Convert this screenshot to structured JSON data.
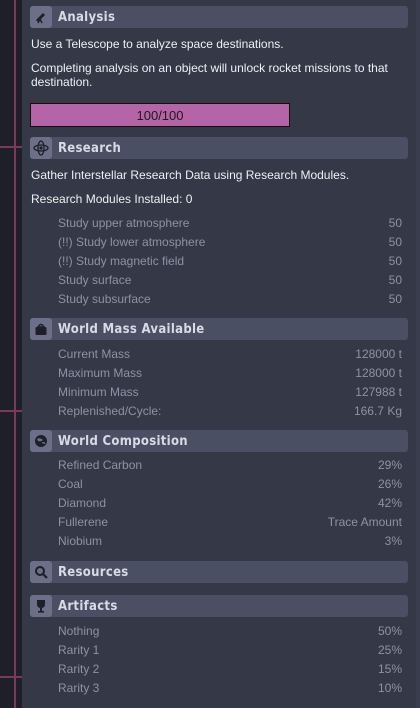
{
  "analysis": {
    "title": "Analysis",
    "icon": "telescope-icon",
    "desc1": "Use a Telescope to analyze space destinations.",
    "desc2": "Completing analysis on an object will unlock rocket missions to that destination.",
    "progress_text": "100/100",
    "progress_value": 1.0
  },
  "research": {
    "title": "Research",
    "icon": "atom-icon",
    "desc": "Gather Interstellar Research Data using Research Modules.",
    "modules": "Research Modules Installed: 0",
    "items": [
      {
        "label": "Study upper atmosphere",
        "value": "50"
      },
      {
        "label": "(!!) Study lower atmosphere",
        "value": "50"
      },
      {
        "label": "(!!) Study magnetic field",
        "value": "50"
      },
      {
        "label": "Study surface",
        "value": "50"
      },
      {
        "label": "Study subsurface",
        "value": "50"
      }
    ]
  },
  "mass": {
    "title": "World Mass Available",
    "icon": "weight-icon",
    "items": [
      {
        "label": "Current Mass",
        "value": "128000 t"
      },
      {
        "label": "Maximum Mass",
        "value": "128000 t"
      },
      {
        "label": "Minimum Mass",
        "value": "127988 t"
      },
      {
        "label": "Replenished/Cycle:",
        "value": "166.7 Kg"
      }
    ]
  },
  "composition": {
    "title": "World Composition",
    "icon": "planet-icon",
    "items": [
      {
        "label": "Refined Carbon",
        "value": "29%"
      },
      {
        "label": "Coal",
        "value": "26%"
      },
      {
        "label": "Diamond",
        "value": "42%"
      },
      {
        "label": "Fullerene",
        "value": "Trace Amount"
      },
      {
        "label": "Niobium",
        "value": "3%"
      }
    ]
  },
  "resources": {
    "title": "Resources",
    "icon": "magnifier-icon"
  },
  "artifacts": {
    "title": "Artifacts",
    "icon": "trophy-icon",
    "items": [
      {
        "label": "Nothing",
        "value": "50%"
      },
      {
        "label": "Rarity 1",
        "value": "25%"
      },
      {
        "label": "Rarity 2",
        "value": "15%"
      },
      {
        "label": "Rarity 3",
        "value": "10%"
      }
    ]
  },
  "colors": {
    "progress_fill": "#b565a7",
    "header_bg": "#4b4f63",
    "panel_bg": "#353847",
    "accent_line": "#7a3a5c"
  }
}
